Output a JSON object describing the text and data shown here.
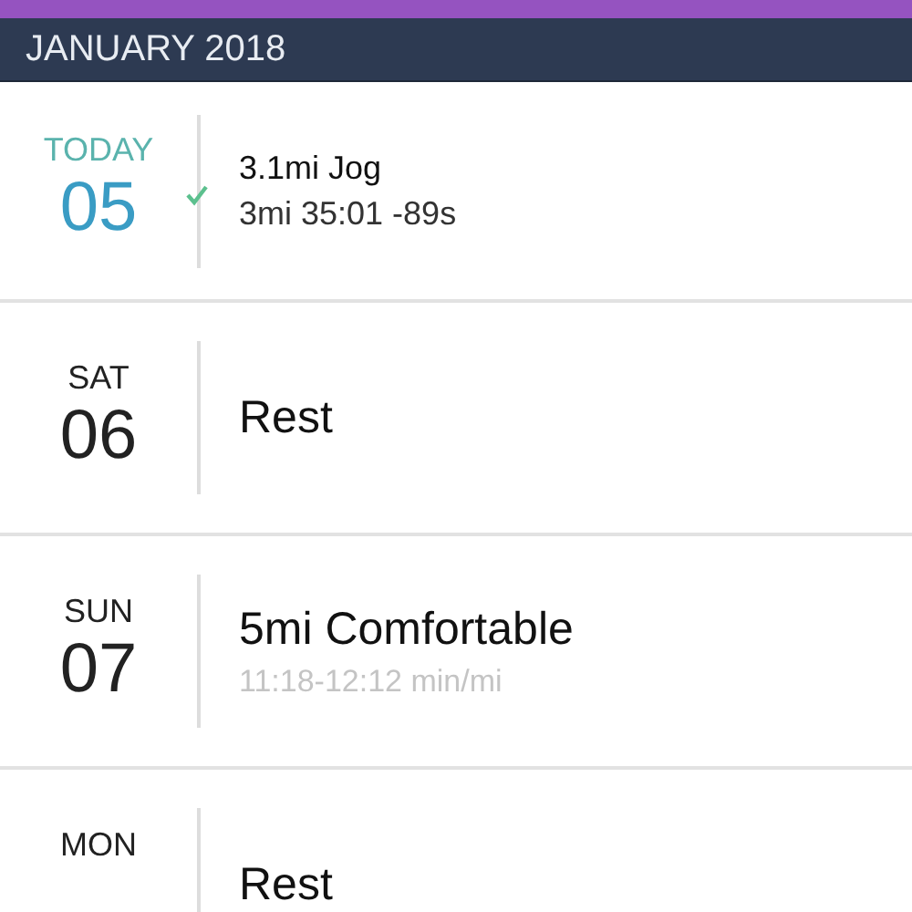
{
  "month_header": "JANUARY 2018",
  "days": [
    {
      "weekday": "TODAY",
      "date": "05",
      "today": true,
      "completed": true,
      "title": "3.1mi Jog",
      "detail": "3mi 35:01 -89s"
    },
    {
      "weekday": "SAT",
      "date": "06",
      "today": false,
      "completed": false,
      "title": "Rest"
    },
    {
      "weekday": "SUN",
      "date": "07",
      "today": false,
      "completed": false,
      "title": "5mi Comfortable",
      "detail": "11:18-12:12 min/mi"
    },
    {
      "weekday": "MON",
      "today": false,
      "completed": false,
      "title": "Rest"
    }
  ]
}
